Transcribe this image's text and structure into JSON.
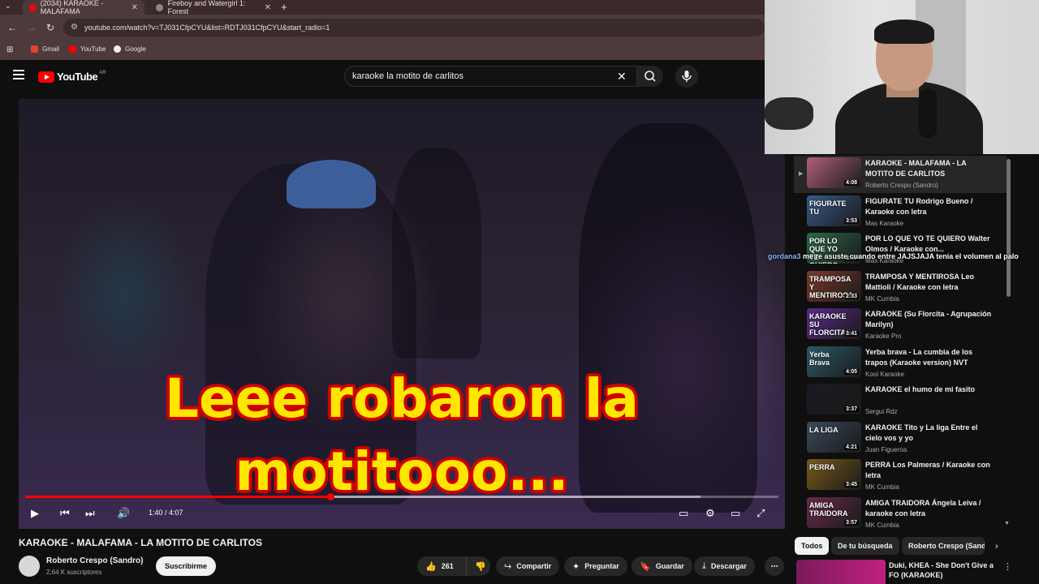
{
  "browser": {
    "tabs": [
      {
        "title": "(2034) KARAOKE - MALAFAMA",
        "active": true,
        "color": "#ff0000"
      },
      {
        "title": "Fireboy and Watergirl 1: Forest",
        "active": false,
        "color": "#888888"
      }
    ],
    "new_tab": "+",
    "url": "youtube.com/watch?v=TJ031CfpCYU&list=RDTJ031CfpCYU&start_radio=1",
    "bookmarks": [
      "Gmail",
      "YouTube",
      "Google"
    ]
  },
  "youtube": {
    "logo_text": "YouTube",
    "country_code": "AR",
    "search_value": "karaoke la motito de carlitos"
  },
  "video": {
    "subtitle_line1": "Leee robaron la",
    "subtitle_line2": "motitooo...",
    "time": "1:40 / 4:07",
    "progress_fraction": 0.405,
    "buffered_fraction": 0.897,
    "title": "KARAOKE - MALAFAMA - LA MOTITO DE CARLITOS",
    "channel": "Roberto Crespo (Sandro)",
    "subscribers": "2,64 K suscriptores",
    "subscribe_label": "Suscribirme",
    "likes": "261",
    "share_label": "Compartir",
    "ask_label": "Preguntar",
    "save_label": "Guardar",
    "download_label": "Descargar"
  },
  "chat": {
    "user": "gordana3",
    "message": "me re asuste cuando entre JAJSJAJA tenia el volumen al palo"
  },
  "playlist": [
    {
      "title": "KARAOKE - MALAFAMA - LA MOTITO DE CARLITOS",
      "channel": "Roberto Crespo (Sandro)",
      "duration": "4:08",
      "thumb_text": "",
      "color": "#b0607a",
      "current": true
    },
    {
      "title": "FIGURATE TU Rodrigo Bueno / Karaoke con letra",
      "channel": "Mas Karaoke",
      "duration": "3:53",
      "thumb_text": "FIGURATE TU",
      "color": "#3a5a8a"
    },
    {
      "title": "POR LO QUE YO TE QUIERO Walter Olmos / Karaoke con...",
      "channel": "Mas Karaoke",
      "duration": "3:47",
      "thumb_text": "POR LO QUE YO TE QUIERO",
      "color": "#2a6a4a"
    },
    {
      "title": "TRAMPOSA Y MENTIROSA Leo Mattioli / Karaoke con letra",
      "channel": "MK Cumbia",
      "duration": "2:33",
      "thumb_text": "TRAMPOSA Y MENTIROSA",
      "color": "#7a3a2a"
    },
    {
      "title": "KARAOKE (Su Florcita - Agrupación Marilyn)",
      "channel": "Karaoke Pro",
      "duration": "3:41",
      "thumb_text": "KARAOKE SU FLORCITA",
      "color": "#5a2a8a"
    },
    {
      "title": "Yerba brava - La cumbia de los trapos (Karaoke version) NVT",
      "channel": "Kool Karaoke",
      "duration": "4:05",
      "thumb_text": "Yerba Brava",
      "color": "#2a5a6a"
    },
    {
      "title": "KARAOKE el humo de mi fasito",
      "channel": "Sergui Rdz",
      "duration": "3:37",
      "thumb_text": "",
      "color": "#1a1a22"
    },
    {
      "title": "KARAOKE Tito y La liga Entre el cielo vos y yo",
      "channel": "Juan Figueroa",
      "duration": "4:21",
      "thumb_text": "LA LIGA",
      "color": "#3a4a5a"
    },
    {
      "title": "PERRA Los Palmeras / Karaoke con letra",
      "channel": "MK Cumbia",
      "duration": "3:45",
      "thumb_text": "PERRA",
      "color": "#7a5a1a"
    },
    {
      "title": "AMIGA TRAIDORA Ángela Leiva / karaoke con letra",
      "channel": "MK Cumbia",
      "duration": "3:57",
      "thumb_text": "AMIGA TRAIDORA",
      "color": "#6a2a4a"
    }
  ],
  "chips": [
    "Todos",
    "De tu búsqueda",
    "Roberto Crespo (Sandro)"
  ],
  "recommendation": {
    "title": "Duki, KHEA - She Don't Give a FO (KARAOKE)"
  }
}
